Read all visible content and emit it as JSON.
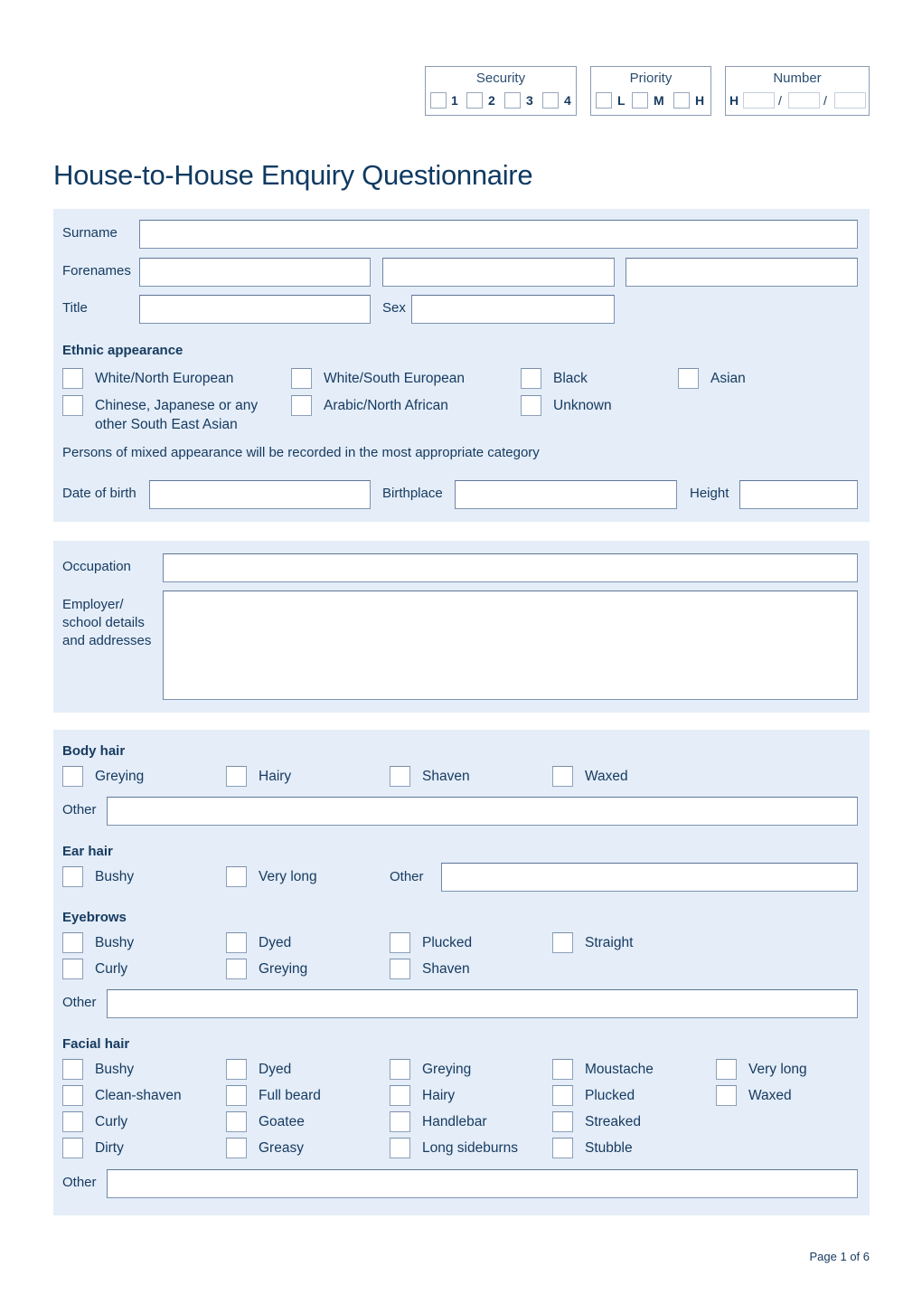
{
  "header_boxes": {
    "security": {
      "label": "Security",
      "options": [
        "1",
        "2",
        "3",
        "4"
      ]
    },
    "priority": {
      "label": "Priority",
      "options": [
        "L",
        "M",
        "H"
      ]
    },
    "number": {
      "label": "Number",
      "prefix": "H",
      "separator": "/"
    }
  },
  "title": "House-to-House Enquiry Questionnaire",
  "personal": {
    "surname_label": "Surname",
    "forenames_label": "Forenames",
    "title_label": "Title",
    "sex_label": "Sex",
    "ethnic": {
      "heading": "Ethnic appearance",
      "options": [
        "White/North European",
        "White/South European",
        "Black",
        "Asian",
        "Chinese, Japanese or any other South East Asian",
        "Arabic/North African",
        "Unknown"
      ],
      "chinese_line1": "Chinese, Japanese or any",
      "chinese_line2": "other South East Asian",
      "note": "Persons of mixed appearance will be recorded in the most appropriate category"
    },
    "dob_label": "Date of birth",
    "birthplace_label": "Birthplace",
    "height_label": "Height"
  },
  "occupation": {
    "occupation_label": "Occupation",
    "employer_line1": "Employer/",
    "employer_line2": "school details",
    "employer_line3": "and addresses"
  },
  "hair": {
    "body_hair": {
      "heading": "Body hair",
      "options": [
        "Greying",
        "Hairy",
        "Shaven",
        "Waxed"
      ],
      "other_label": "Other"
    },
    "ear_hair": {
      "heading": "Ear hair",
      "options": [
        "Bushy",
        "Very long"
      ],
      "other_label": "Other"
    },
    "eyebrows": {
      "heading": "Eyebrows",
      "options": [
        "Bushy",
        "Dyed",
        "Plucked",
        "Straight",
        "Curly",
        "Greying",
        "Shaven"
      ],
      "other_label": "Other"
    },
    "facial_hair": {
      "heading": "Facial hair",
      "options": [
        "Bushy",
        "Dyed",
        "Greying",
        "Moustache",
        "Very long",
        "Clean-shaven",
        "Full beard",
        "Hairy",
        "Plucked",
        "Waxed",
        "Curly",
        "Goatee",
        "Handlebar",
        "Streaked",
        "Dirty",
        "Greasy",
        "Long sideburns",
        "Stubble"
      ],
      "other_label": "Other"
    }
  },
  "footer": {
    "page": "Page 1 of 6"
  }
}
